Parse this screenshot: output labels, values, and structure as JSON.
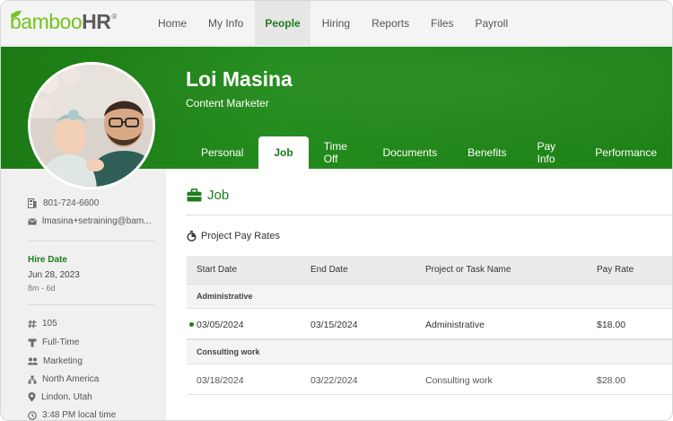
{
  "brand": {
    "word": "bamboo",
    "hr": "HR",
    "reg": "®"
  },
  "nav": {
    "items": [
      {
        "label": "Home"
      },
      {
        "label": "My Info"
      },
      {
        "label": "People"
      },
      {
        "label": "Hiring"
      },
      {
        "label": "Reports"
      },
      {
        "label": "Files"
      },
      {
        "label": "Payroll"
      }
    ],
    "active": "People"
  },
  "profile": {
    "name": "Loi Masina",
    "title": "Content Marketer"
  },
  "tabs": {
    "items": [
      {
        "label": "Personal"
      },
      {
        "label": "Job"
      },
      {
        "label": "Time Off"
      },
      {
        "label": "Documents"
      },
      {
        "label": "Benefits"
      },
      {
        "label": "Pay Info"
      },
      {
        "label": "Performance"
      }
    ],
    "active": "Job"
  },
  "sidebar": {
    "phone": "801-724-6600",
    "email": "lmasina+setraining@bam...",
    "hire_label": "Hire Date",
    "hire_date": "Jun 28, 2023",
    "hire_duration": "8m - 6d",
    "employee_number": "105",
    "employment_type": "Full-Time",
    "department": "Marketing",
    "division": "North America",
    "location": "Lindon, Utah",
    "local_time": "3:48 PM local time"
  },
  "main": {
    "title": "Job",
    "section_title": "Project Pay Rates",
    "table": {
      "headers": [
        "Start Date",
        "End Date",
        "Project or Task Name",
        "Pay Rate"
      ],
      "groups": [
        {
          "name": "Administrative",
          "rows": [
            {
              "start": "03/05/2024",
              "end": "03/15/2024",
              "project": "Administrative",
              "rate": "$18.00"
            }
          ]
        },
        {
          "name": "Consulting work",
          "rows": [
            {
              "start": "03/18/2024",
              "end": "03/22/2024",
              "project": "Consulting work",
              "rate": "$28.00"
            }
          ]
        }
      ]
    }
  },
  "colors": {
    "brand_green": "#1e7c1e",
    "banner_green": "#238b1c",
    "logo_green": "#73c41d"
  }
}
